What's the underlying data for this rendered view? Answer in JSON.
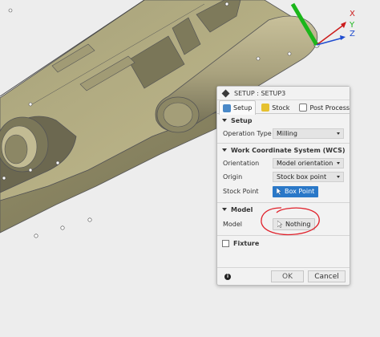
{
  "axes": {
    "x": "X",
    "y": "Y",
    "z": "Z"
  },
  "dialog": {
    "title": "SETUP : SETUP3",
    "tabs": [
      {
        "label": "Setup",
        "icon": "setup-icon"
      },
      {
        "label": "Stock",
        "icon": "stock-icon"
      },
      {
        "label": "Post Process",
        "icon": "post-process-icon"
      }
    ],
    "setup_section": {
      "title": "Setup",
      "operation_type_label": "Operation Type",
      "operation_type_value": "Milling"
    },
    "wcs_section": {
      "title": "Work Coordinate System (WCS)",
      "orientation_label": "Orientation",
      "orientation_value": "Model orientation",
      "origin_label": "Origin",
      "origin_value": "Stock box point",
      "stock_point_label": "Stock Point",
      "stock_point_button": "Box Point"
    },
    "model_section": {
      "title": "Model",
      "model_label": "Model",
      "model_button": "Nothing"
    },
    "fixture_section": {
      "title": "Fixture"
    },
    "footer": {
      "info": "i",
      "ok": "OK",
      "cancel": "Cancel"
    }
  },
  "colors": {
    "part_top": "#bdb58a",
    "part_side": "#8f8a66",
    "accent_blue": "#2a78c8",
    "annotation_red": "#e0202a"
  }
}
